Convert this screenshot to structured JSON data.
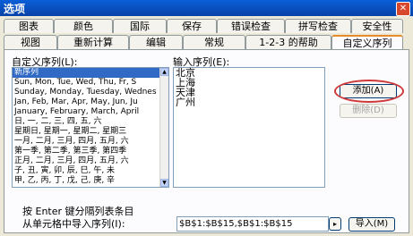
{
  "window": {
    "title": "选项",
    "close_glyph": "✕"
  },
  "tabs_row1": [
    {
      "label": "图表"
    },
    {
      "label": "颜色"
    },
    {
      "label": "国际"
    },
    {
      "label": "保存"
    },
    {
      "label": "错误检查"
    },
    {
      "label": "拼写检查"
    },
    {
      "label": "安全性"
    }
  ],
  "tabs_row2": [
    {
      "label": "视图"
    },
    {
      "label": "重新计算"
    },
    {
      "label": "编辑"
    },
    {
      "label": "常规"
    },
    {
      "label": "1-2-3 的帮助"
    },
    {
      "label": "自定义序列"
    }
  ],
  "panel": {
    "custom_lists_label": "自定义序列(L):",
    "custom_lists": [
      "新序列",
      "Sun, Mon, Tue, Wed, Thu, Fr, S",
      "Sunday, Monday, Tuesday, Wednes",
      "Jan, Feb, Mar, Apr, May, Jun, Ju",
      "January, February, March, April",
      "日, 一, 二, 三, 四, 五, 六",
      "星期日, 星期一, 星期二, 星期三",
      "一月, 二月, 三月, 四月, 五月, 六",
      "第一季, 第二季, 第三季, 第四季",
      "正月, 二月, 三月, 四月, 五月, 六",
      "子, 丑, 寅, 卯, 辰, 巳, 午, 未",
      "甲, 乙, 丙, 丁, 戊, 己, 庚, 辛"
    ],
    "entries_label": "输入序列(E):",
    "entries": [
      "北京",
      "上海",
      "天津",
      "广州"
    ],
    "add_button": "添加(A)",
    "delete_button": "删除(D)",
    "instruction_line1": "按 Enter 键分隔列表条目",
    "instruction_line2": "从单元格中导入序列(I):",
    "import_range_value": "$B$1:$B$15,$B$1:$B$15",
    "import_button": "导入(M)"
  },
  "colors": {
    "highlight_ring": "#d0393a",
    "selection": "#316ac5"
  }
}
